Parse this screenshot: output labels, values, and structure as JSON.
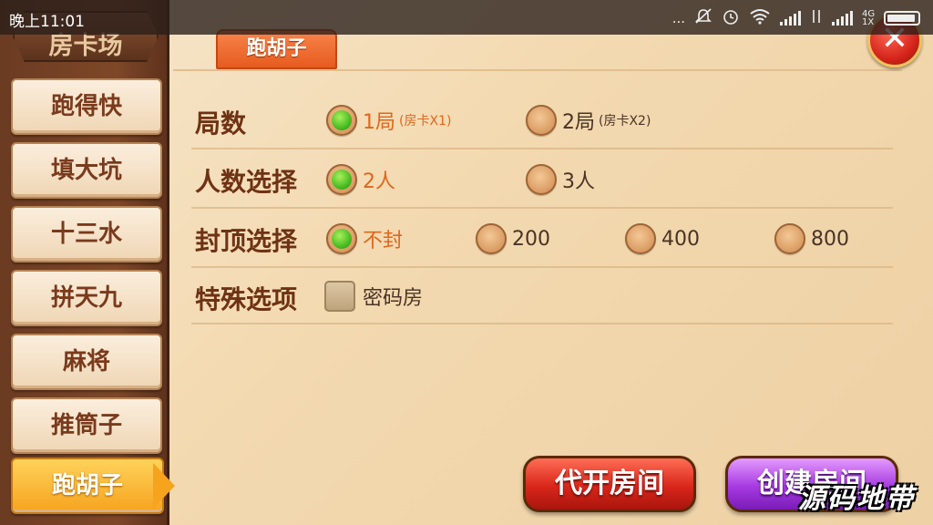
{
  "status_bar": {
    "time": "晚上11:01",
    "dots": "...",
    "net_label": "4G 1X"
  },
  "sidebar": {
    "title": "房卡场",
    "items": [
      {
        "label": "跑得快",
        "active": false
      },
      {
        "label": "填大坑",
        "active": false
      },
      {
        "label": "十三水",
        "active": false
      },
      {
        "label": "拼天九",
        "active": false
      },
      {
        "label": "麻将",
        "active": false
      },
      {
        "label": "推筒子",
        "active": false
      },
      {
        "label": "跑胡子",
        "active": true
      }
    ]
  },
  "tab": {
    "label": "跑胡子"
  },
  "close": {
    "label": "✕"
  },
  "rows": {
    "rounds": {
      "label": "局数",
      "options": [
        {
          "text": "1局",
          "sub": "(房卡X1)",
          "selected": true
        },
        {
          "text": "2局",
          "sub": "(房卡X2)",
          "selected": false
        }
      ]
    },
    "players": {
      "label": "人数选择",
      "options": [
        {
          "text": "2人",
          "selected": true
        },
        {
          "text": "3人",
          "selected": false
        }
      ]
    },
    "cap": {
      "label": "封顶选择",
      "options": [
        {
          "text": "不封",
          "selected": true
        },
        {
          "text": "200",
          "selected": false
        },
        {
          "text": "400",
          "selected": false
        },
        {
          "text": "800",
          "selected": false
        }
      ]
    },
    "special": {
      "label": "特殊选项",
      "options": [
        {
          "text": "密码房",
          "checked": false
        }
      ]
    }
  },
  "buttons": {
    "open_for_others": "代开房间",
    "create_room": "创建房间"
  },
  "watermark": "源码地带",
  "colors": {
    "selected_text": "#e0661c",
    "radio_selected": "#42b81f",
    "tab_active": "#e65b1f",
    "nav_active": "#f6a31d"
  }
}
